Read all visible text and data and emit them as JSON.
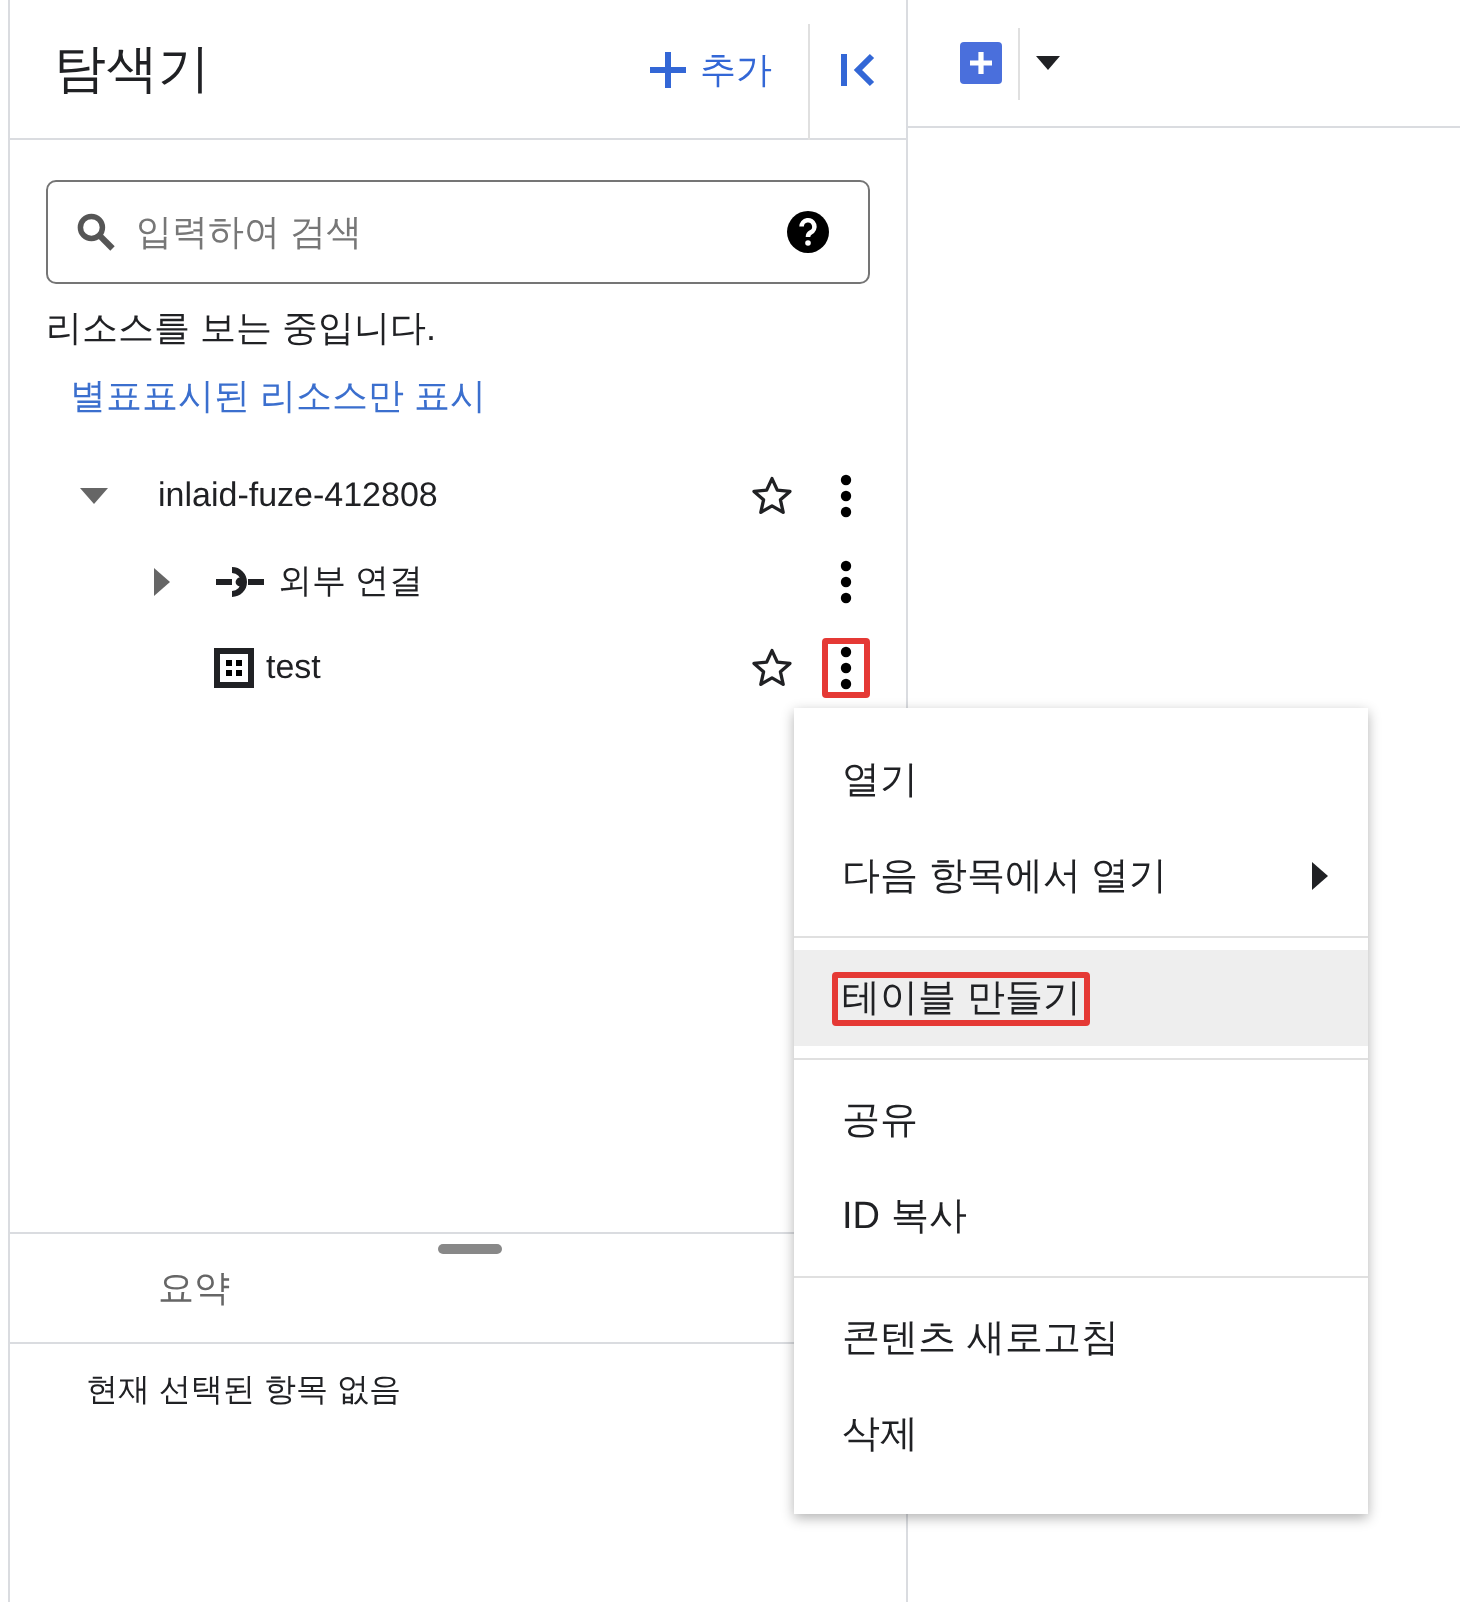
{
  "explorer": {
    "title": "탐색기",
    "add_button": "추가",
    "search": {
      "placeholder": "입력하여 검색"
    },
    "status_text": "리소스를 보는 중입니다.",
    "starred_filter_link": "별표표시된 리소스만 표시",
    "tree": [
      {
        "label": "inlaid-fuze-412808",
        "expanded": true,
        "starred": false,
        "highlighted": false,
        "children": [
          {
            "label": "외부 연결",
            "kind": "connection",
            "expanded": false,
            "highlighted": false
          },
          {
            "label": "test",
            "kind": "dataset",
            "starred": false,
            "highlighted": true
          }
        ]
      }
    ],
    "details": {
      "tabs": [
        {
          "label": "요약",
          "selected": false
        }
      ],
      "empty_text": "현재 선택된 항목 없음"
    }
  },
  "context_menu": {
    "groups": [
      {
        "items": [
          {
            "label": "열기",
            "submenu": false,
            "hovered": false,
            "highlighted": false
          },
          {
            "label": "다음 항목에서 열기",
            "submenu": true,
            "hovered": false,
            "highlighted": false
          }
        ]
      },
      {
        "items": [
          {
            "label": "테이블 만들기",
            "submenu": false,
            "hovered": true,
            "highlighted": true
          }
        ]
      },
      {
        "items": [
          {
            "label": "공유",
            "submenu": false,
            "hovered": false,
            "highlighted": false
          },
          {
            "label": "ID 복사",
            "submenu": false,
            "hovered": false,
            "highlighted": false
          }
        ]
      },
      {
        "items": [
          {
            "label": "콘텐츠 새로고침",
            "submenu": false,
            "hovered": false,
            "highlighted": false
          },
          {
            "label": "삭제",
            "submenu": false,
            "hovered": false,
            "highlighted": false
          }
        ]
      }
    ]
  }
}
